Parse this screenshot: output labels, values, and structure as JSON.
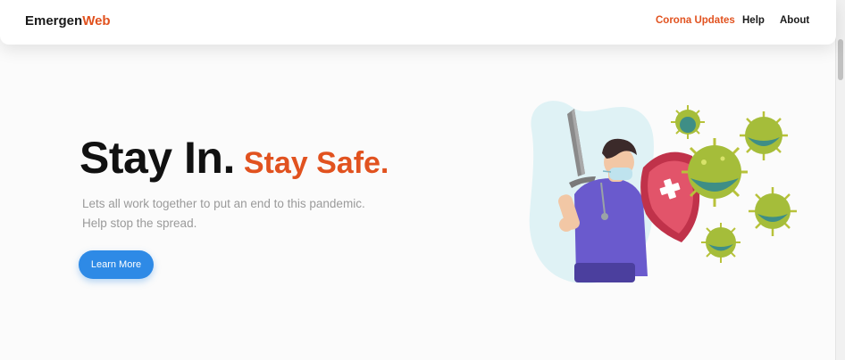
{
  "brand": {
    "name_main": "Emergen",
    "name_accent": "Web"
  },
  "nav": {
    "links": [
      {
        "label": "Corona Updates",
        "active": true
      },
      {
        "label": "Help",
        "active": false
      },
      {
        "label": "About",
        "active": false
      }
    ]
  },
  "hero": {
    "title_primary": "Stay In.",
    "title_secondary": "Stay Safe.",
    "description_line1": "Lets all work together to put an end to this pandemic.",
    "description_line2": "Help stop the spread.",
    "cta_label": "Learn More"
  },
  "colors": {
    "accent": "#e1521f",
    "button": "#2e8ae6",
    "text_dark": "#111111",
    "text_muted": "#9a9a9a"
  },
  "icons": [
    "doctor-with-sword-and-shield-illustration",
    "virus-icon"
  ]
}
